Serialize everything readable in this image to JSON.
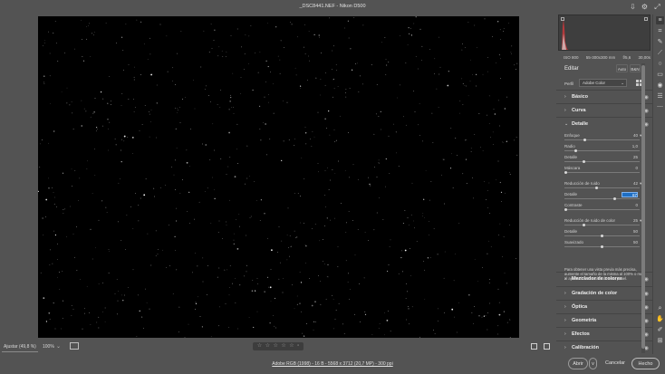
{
  "window": {
    "title": "_DSC8441.NEF - Nikon D500"
  },
  "titlebar_icons": [
    "export-icon",
    "gear-icon",
    "fullscreen-icon"
  ],
  "zoom": {
    "fit_label": "Ajustar (49,8 %)",
    "percent": "100%"
  },
  "rating": {
    "stars": [
      "☆",
      "☆",
      "☆",
      "☆",
      "☆"
    ],
    "label_marker": ""
  },
  "status": {
    "image_info": "Adobe RGB (1998) - 16 B - 5568 x 3712 (20,7 MP) - 300 ppi",
    "open_label": "Abrir",
    "open_menu": "v",
    "cancel_label": "Cancelar",
    "done_label": "Hecho"
  },
  "exif": {
    "iso": "ISO 800",
    "lens": "55-300x300 mm",
    "aperture": "f/5,6",
    "shutter": "30,00s"
  },
  "editor": {
    "title": "Editar",
    "auto_label": "Auto",
    "bw_label": "B&N",
    "profile_label": "Perfil",
    "profile_value": "Adobe Color"
  },
  "sections_top": [
    {
      "label": "Básico"
    },
    {
      "label": "Curva"
    },
    {
      "label": "Detalle"
    }
  ],
  "detail": {
    "sharpening": [
      {
        "label": "Enfoque",
        "value": "40",
        "level": 40,
        "max": 150
      },
      {
        "label": "Radio",
        "value": "1,0",
        "level": 0.4,
        "max": 3
      },
      {
        "label": "Detalle",
        "value": "25",
        "level": 25,
        "max": 100
      },
      {
        "label": "Máscara",
        "value": "0",
        "level": 0,
        "max": 100
      }
    ],
    "noise": [
      {
        "label": "Reducción de ruido",
        "value": "42",
        "level": 42,
        "max": 100
      },
      {
        "label": "Detalle",
        "value": "67",
        "level": 67,
        "max": 100,
        "editing": true
      },
      {
        "label": "Contraste",
        "value": "0",
        "level": 0,
        "max": 100
      }
    ],
    "color_noise": [
      {
        "label": "Reducción de ruido de color",
        "value": "25",
        "level": 25,
        "max": 100
      },
      {
        "label": "Detalle",
        "value": "50",
        "level": 50,
        "max": 100
      },
      {
        "label": "Suavizado",
        "value": "50",
        "level": 50,
        "max": 100
      }
    ],
    "note": "Para obtener una vista previa más precisa, aumente el tamaño de la misma al 100% o más al ajustar los controles de este panel."
  },
  "sections_bottom": [
    {
      "label": "Mezclador de colores"
    },
    {
      "label": "Gradación de color"
    },
    {
      "label": "Óptica"
    },
    {
      "label": "Geometría"
    },
    {
      "label": "Efectos"
    },
    {
      "label": "Calibración"
    }
  ],
  "tools": [
    "edit-sliders-icon",
    "crop-icon",
    "heal-icon",
    "mask-brush-icon",
    "radial-filter-icon",
    "gradient-filter-icon",
    "redeye-icon",
    "presets-icon",
    "more-icon",
    "zoom-icon",
    "hand-icon",
    "color-sampler-icon",
    "grid-toggle-icon"
  ],
  "colors": {
    "background": "#535353",
    "photo": "#000000",
    "accent": "#1f6fc4",
    "histogram_red": "#c0393b"
  }
}
